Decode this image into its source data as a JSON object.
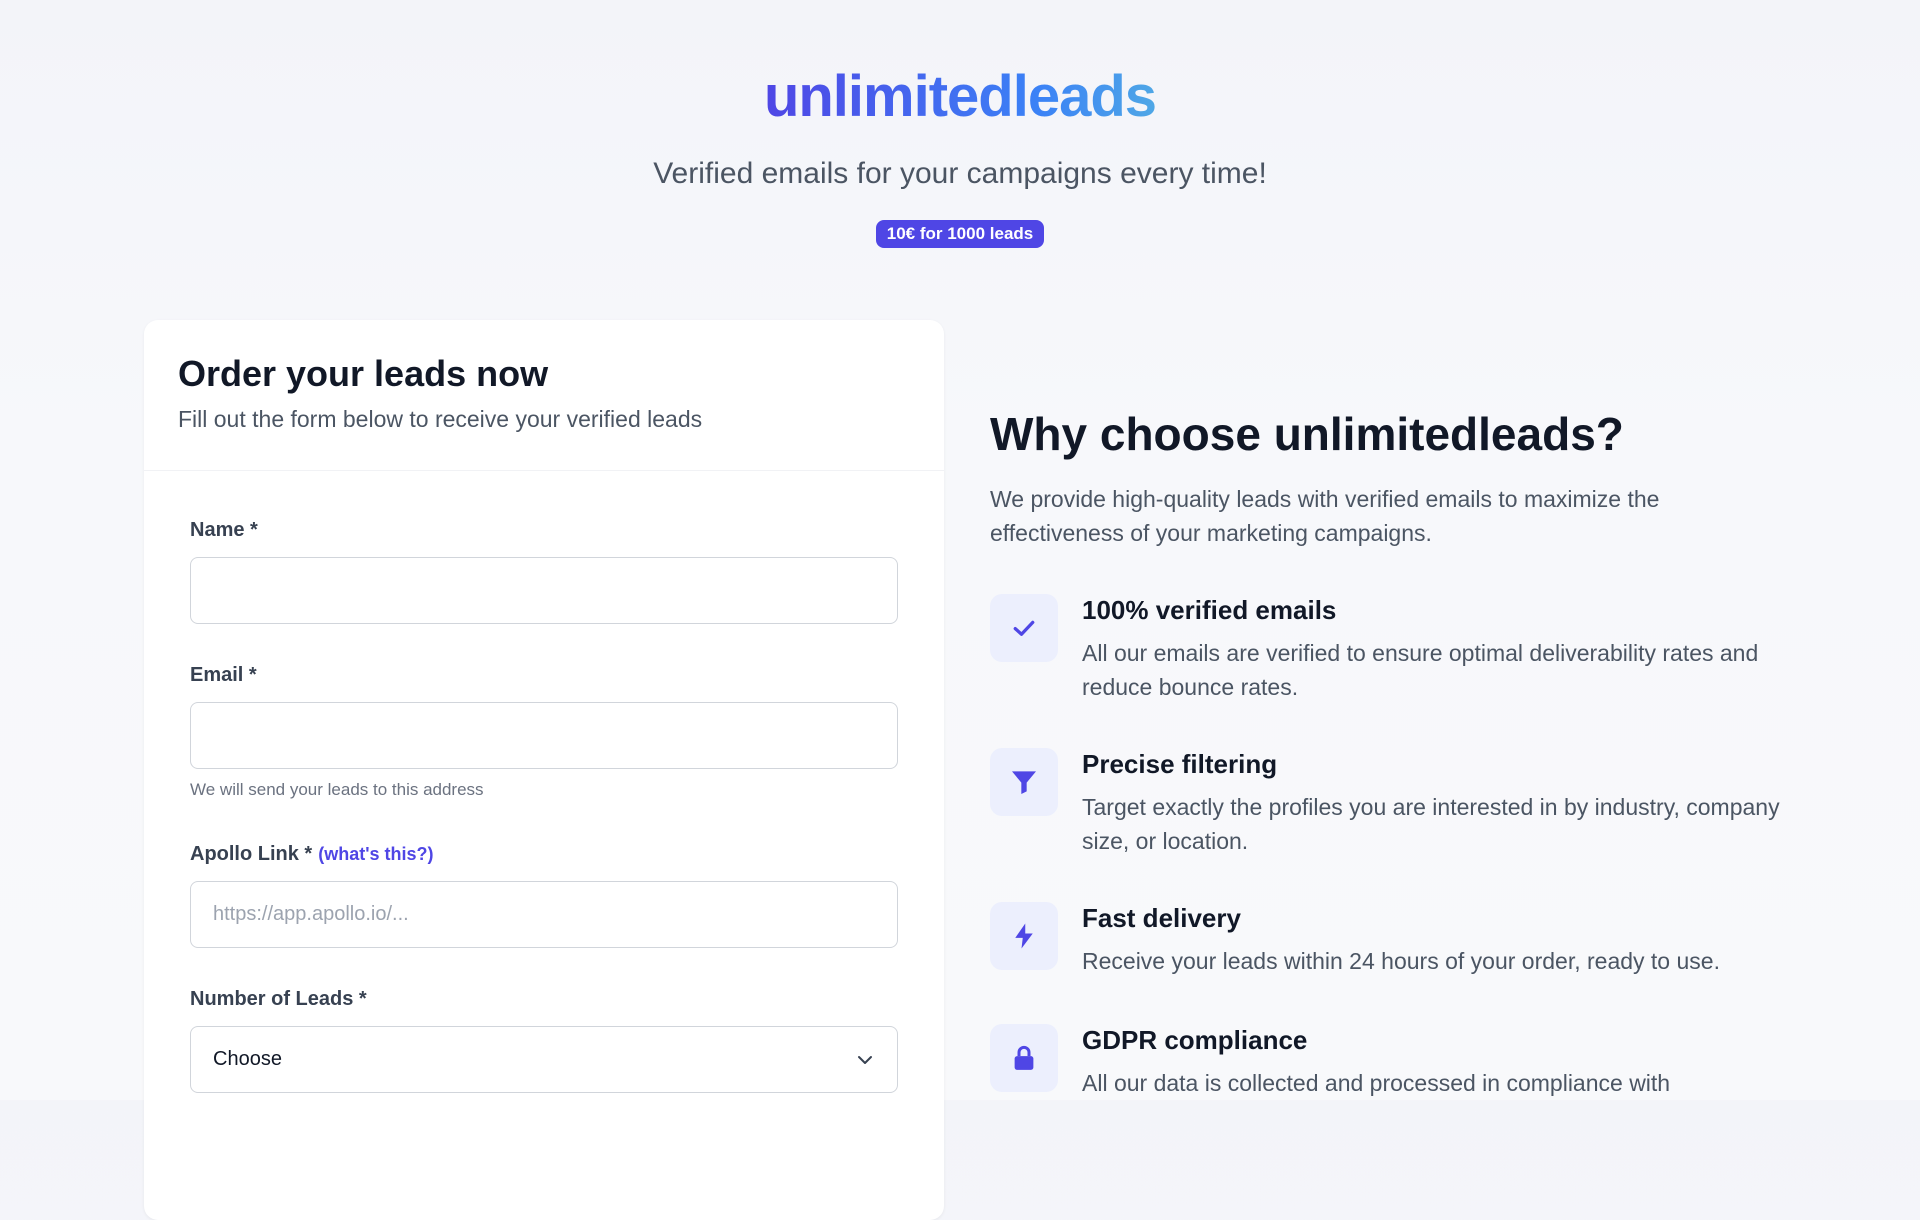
{
  "header": {
    "logo": "unlimitedleads",
    "tagline": "Verified emails for your campaigns every time!",
    "badge": "10€ for 1000 leads"
  },
  "form_card": {
    "title": "Order your leads now",
    "subtitle": "Fill out the form below to receive your verified leads",
    "fields": {
      "name": {
        "label": "Name *",
        "value": ""
      },
      "email": {
        "label": "Email *",
        "value": "",
        "hint": "We will send your leads to this address"
      },
      "apollo": {
        "label": "Apollo Link *",
        "help_link": "(what's this?)",
        "placeholder": "https://app.apollo.io/..."
      },
      "leads": {
        "label": "Number of Leads *",
        "selected": "Choose"
      }
    }
  },
  "why": {
    "title": "Why choose unlimitedleads?",
    "text": "We provide high-quality leads with verified emails to maximize the effectiveness of your marketing campaigns.",
    "features": [
      {
        "icon": "check-icon",
        "title": "100% verified emails",
        "text": "All our emails are verified to ensure optimal deliverability rates and reduce bounce rates."
      },
      {
        "icon": "filter-icon",
        "title": "Precise filtering",
        "text": "Target exactly the profiles you are interested in by industry, company size, or location."
      },
      {
        "icon": "lightning-icon",
        "title": "Fast delivery",
        "text": "Receive your leads within 24 hours of your order, ready to use."
      },
      {
        "icon": "lock-icon",
        "title": "GDPR compliance",
        "text": "All our data is collected and processed in compliance with"
      }
    ]
  },
  "colors": {
    "accent": "#4f46e5",
    "icon_bg": "#eceffd"
  }
}
